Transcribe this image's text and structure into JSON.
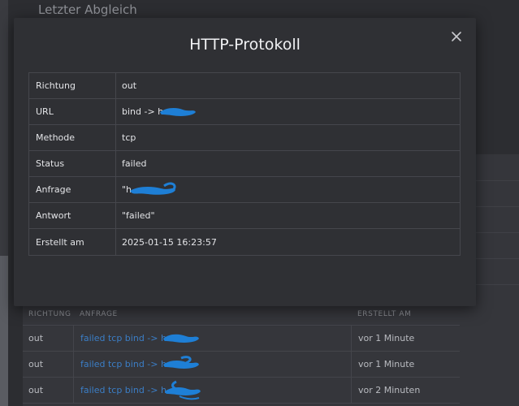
{
  "background": {
    "heading": "Letzter Abgleich",
    "table": {
      "headers": [
        "RICHTUNG",
        "ANFRAGE",
        "ERSTELLT AM"
      ],
      "rows": [
        {
          "direction": "out",
          "request": "failed tcp bind -> h",
          "created": "vor 1 Minute"
        },
        {
          "direction": "out",
          "request": "failed tcp bind -> h",
          "created": "vor 1 Minute"
        },
        {
          "direction": "out",
          "request": "failed tcp bind -> h",
          "created": "vor 2 Minuten"
        }
      ]
    }
  },
  "modal": {
    "title": "HTTP-Protokoll",
    "close_icon": "close-icon",
    "rows": [
      {
        "key": "Richtung",
        "value": "out"
      },
      {
        "key": "URL",
        "value": "bind -> h"
      },
      {
        "key": "Methode",
        "value": "tcp"
      },
      {
        "key": "Status",
        "value": "failed"
      },
      {
        "key": "Anfrage",
        "value": "\"h"
      },
      {
        "key": "Antwort",
        "value": "\"failed\""
      },
      {
        "key": "Erstellt am",
        "value": "2025-01-15 16:23:57"
      }
    ]
  },
  "colors": {
    "link": "#3b7ec6",
    "redaction": "#1e7fd6"
  }
}
